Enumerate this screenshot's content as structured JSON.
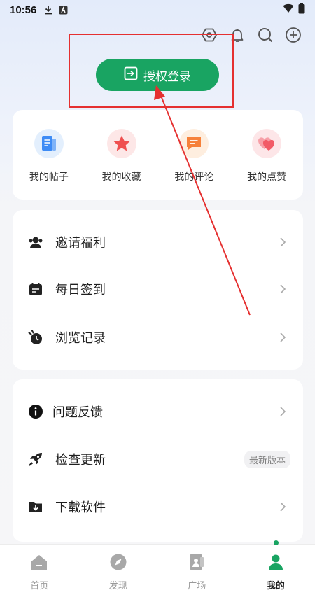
{
  "status_bar": {
    "time": "10:56",
    "download_icon": "download-icon",
    "app_icon": "a-icon",
    "wifi": "wifi-icon",
    "battery": "battery-icon"
  },
  "header_icons": [
    "settings-hex-icon",
    "bell-icon",
    "search-icon",
    "add-icon"
  ],
  "login_button": {
    "label": "授权登录",
    "icon": "login-arrow-icon"
  },
  "quick_actions": [
    {
      "label": "我的帖子",
      "icon": "posts-icon",
      "color": "#3d8bf5"
    },
    {
      "label": "我的收藏",
      "icon": "star-icon",
      "color": "#ef4f4f"
    },
    {
      "label": "我的评论",
      "icon": "comment-icon",
      "color": "#f6813a"
    },
    {
      "label": "我的点赞",
      "icon": "hearts-icon",
      "color": "#f25b67"
    }
  ],
  "menu_group1": [
    {
      "label": "邀请福利",
      "icon": "invite-icon"
    },
    {
      "label": "每日签到",
      "icon": "calendar-icon"
    },
    {
      "label": "浏览记录",
      "icon": "history-icon"
    }
  ],
  "menu_group2": [
    {
      "label": "问题反馈",
      "icon": "info-icon"
    },
    {
      "label": "检查更新",
      "icon": "rocket-icon",
      "badge": "最新版本"
    },
    {
      "label": "下载软件",
      "icon": "download-folder-icon"
    }
  ],
  "tabs": [
    {
      "label": "首页",
      "icon": "home-icon",
      "active": false
    },
    {
      "label": "发现",
      "icon": "compass-icon",
      "active": false
    },
    {
      "label": "广场",
      "icon": "square-icon",
      "active": false
    },
    {
      "label": "我的",
      "icon": "profile-icon",
      "active": true
    }
  ],
  "colors": {
    "accent": "#19a462",
    "annotation": "#e53030"
  }
}
